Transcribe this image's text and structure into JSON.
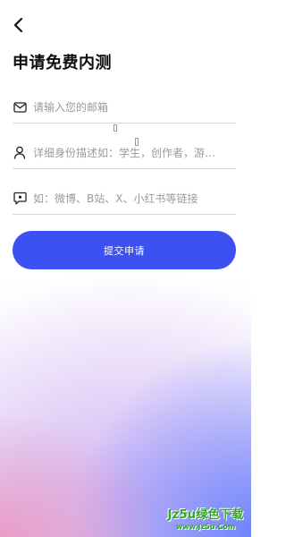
{
  "header": {
    "back_icon": "chevron-left-icon",
    "title": "申请免费内测"
  },
  "form": {
    "email": {
      "icon": "mail-icon",
      "placeholder": "请输入您的邮箱",
      "value": ""
    },
    "identity": {
      "icon": "user-icon",
      "placeholder": "详细身份描述如：学生，创作者，游…",
      "value": ""
    },
    "social": {
      "icon": "chat-link-icon",
      "placeholder": "如：微博、B站、X、小红书等链接",
      "value": ""
    },
    "submit_label": "提交申请"
  },
  "watermark": {
    "main": "Jz5u绿色下载",
    "url": "www.Jz5u.Com"
  },
  "colors": {
    "accent": "#3d51f3",
    "watermark": "#2fa824"
  }
}
